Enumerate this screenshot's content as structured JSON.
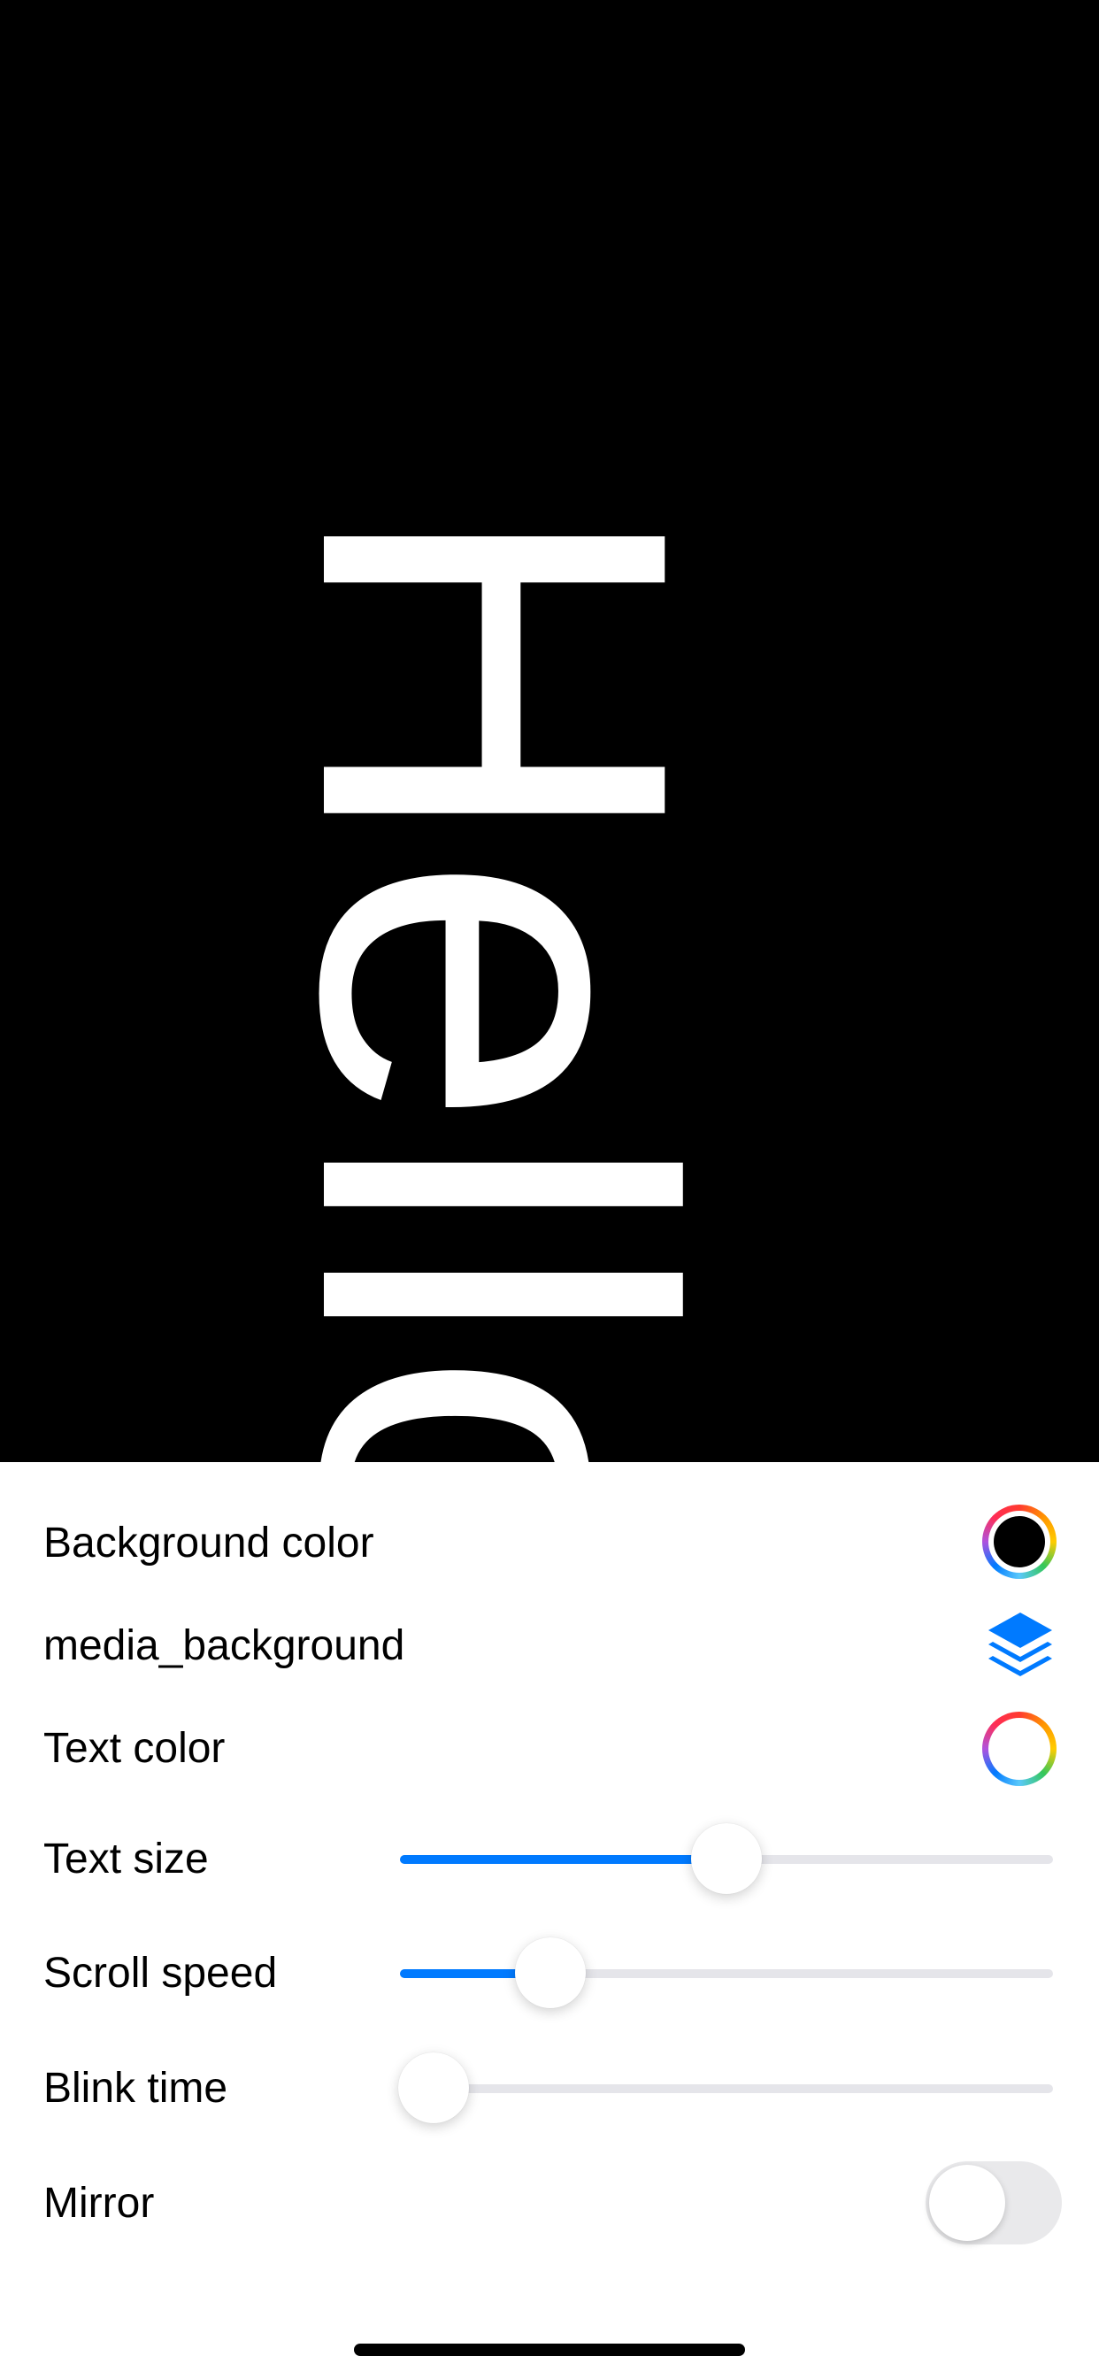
{
  "preview": {
    "text": "Hello",
    "background_color": "#000000",
    "text_color": "#ffffff"
  },
  "settings": {
    "background_color": {
      "label": "Background color",
      "icon": "color-wheel-icon",
      "value": "#000000"
    },
    "media_background": {
      "label": "media_background",
      "icon": "layers-icon",
      "icon_color": "#007aff"
    },
    "text_color": {
      "label": "Text color",
      "icon": "color-wheel-icon",
      "value": "#ffffff"
    },
    "text_size": {
      "label": "Text size",
      "value": 0.5
    },
    "scroll_speed": {
      "label": "Scroll speed",
      "value": 0.2
    },
    "blink_time": {
      "label": "Blink time",
      "value": 0.0
    },
    "mirror": {
      "label": "Mirror",
      "on": false
    }
  },
  "colors": {
    "accent": "#007aff",
    "track": "#e5e5ea",
    "toggle_off": "#e9e9eb"
  }
}
